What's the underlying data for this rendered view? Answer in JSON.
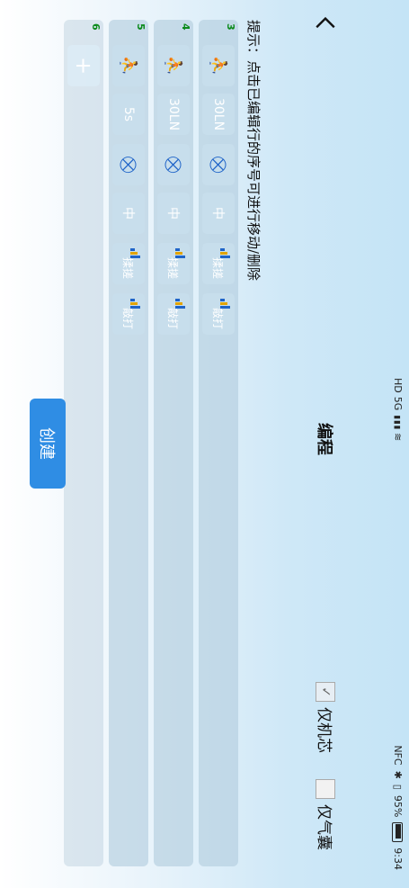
{
  "status": {
    "left": [
      "HD",
      "5G",
      "▮▮▮",
      "wifi"
    ],
    "right": [
      "NFC",
      "BT",
      "vib",
      "95%",
      "9:34"
    ]
  },
  "header": {
    "title": "编程",
    "options": [
      {
        "label": "仅机芯",
        "checked": true
      },
      {
        "label": "仅气囊",
        "checked": false
      }
    ]
  },
  "hint": "提示：点击已编辑行的序号可进行移动/删除",
  "rows": [
    {
      "num": "3",
      "cells": [
        "30LN",
        "中",
        "揉搓",
        "敲打"
      ]
    },
    {
      "num": "4",
      "cells": [
        "30LN",
        "中",
        "揉搓",
        "敲打"
      ]
    },
    {
      "num": "5",
      "cells": [
        "5s",
        "中",
        "揉搓",
        "敲打"
      ]
    },
    {
      "num": "6",
      "add": "+"
    }
  ],
  "create_label": "创建",
  "colors": {
    "primary": "#2f8de4",
    "row": "#b4cedf",
    "rownum": "#0a8a1a"
  }
}
